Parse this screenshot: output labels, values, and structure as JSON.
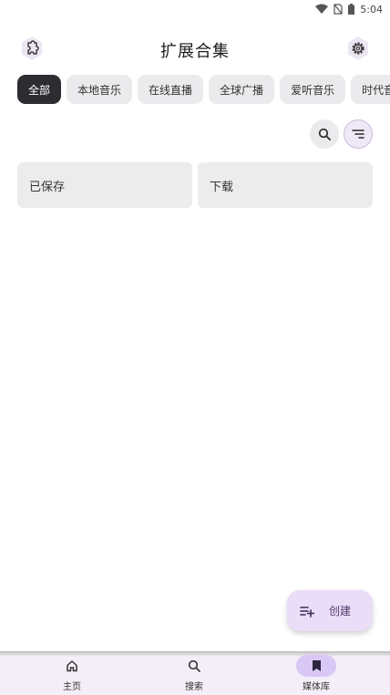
{
  "status_bar": {
    "time": "5:04",
    "icons": [
      "wifi-icon",
      "no-sim-icon",
      "battery-icon"
    ]
  },
  "header": {
    "title": "扩展合集",
    "left_icon": "puzzle-icon",
    "right_icon": "gear-icon"
  },
  "chips": [
    {
      "label": "全部",
      "selected": true
    },
    {
      "label": "本地音乐",
      "selected": false
    },
    {
      "label": "在线直播",
      "selected": false
    },
    {
      "label": "全球广播",
      "selected": false
    },
    {
      "label": "爱听音乐",
      "selected": false
    },
    {
      "label": "时代音乐",
      "selected": false
    }
  ],
  "tools": {
    "search_icon": "search-icon",
    "sort_icon": "sort-icon"
  },
  "cards": [
    {
      "label": "已保存"
    },
    {
      "label": "下载"
    }
  ],
  "fab": {
    "label": "创建",
    "icon": "playlist-add-icon"
  },
  "bottom_nav": [
    {
      "label": "主页",
      "icon": "home-icon",
      "active": false
    },
    {
      "label": "搜索",
      "icon": "search-icon",
      "active": false
    },
    {
      "label": "媒体库",
      "icon": "bookmark-icon",
      "active": true
    }
  ],
  "colors": {
    "accent": "#eaddf8",
    "active_indicator": "#d9c8f5",
    "selected_chip": "#2d2c31",
    "chip": "#ebeaed",
    "card": "#ececec"
  }
}
